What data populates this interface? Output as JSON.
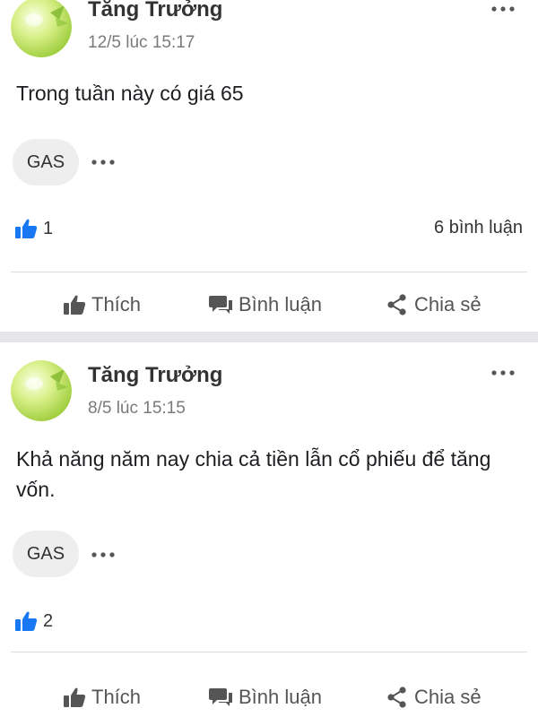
{
  "posts": [
    {
      "author": "Tăng Trưởng",
      "timestamp": "12/5 lúc 15:17",
      "text": "Trong tuần này có giá 65",
      "tag": "GAS",
      "likes": "1",
      "comments": "6 bình luận",
      "actions": {
        "like": "Thích",
        "comment": "Bình luận",
        "share": "Chia sẻ"
      }
    },
    {
      "author": "Tăng Trưởng",
      "timestamp": "8/5 lúc 15:15",
      "text": "Khả năng năm nay chia cả tiền lẫn cổ phiếu để tăng vốn.",
      "tag": "GAS",
      "likes": "2",
      "actions": {
        "like": "Thích",
        "comment": "Bình luận",
        "share": "Chia sẻ"
      }
    }
  ],
  "icons": {
    "more": "more-horizontal-icon",
    "like_reaction": "thumbs-up-icon",
    "like_action": "thumbs-up-icon",
    "comment_action": "comment-icon",
    "share_action": "share-icon"
  },
  "colors": {
    "like_blue": "#1877f2",
    "separator": "#e4e6e9",
    "chip_bg": "#eeeeee",
    "secondary_text": "#7a7a7a"
  }
}
